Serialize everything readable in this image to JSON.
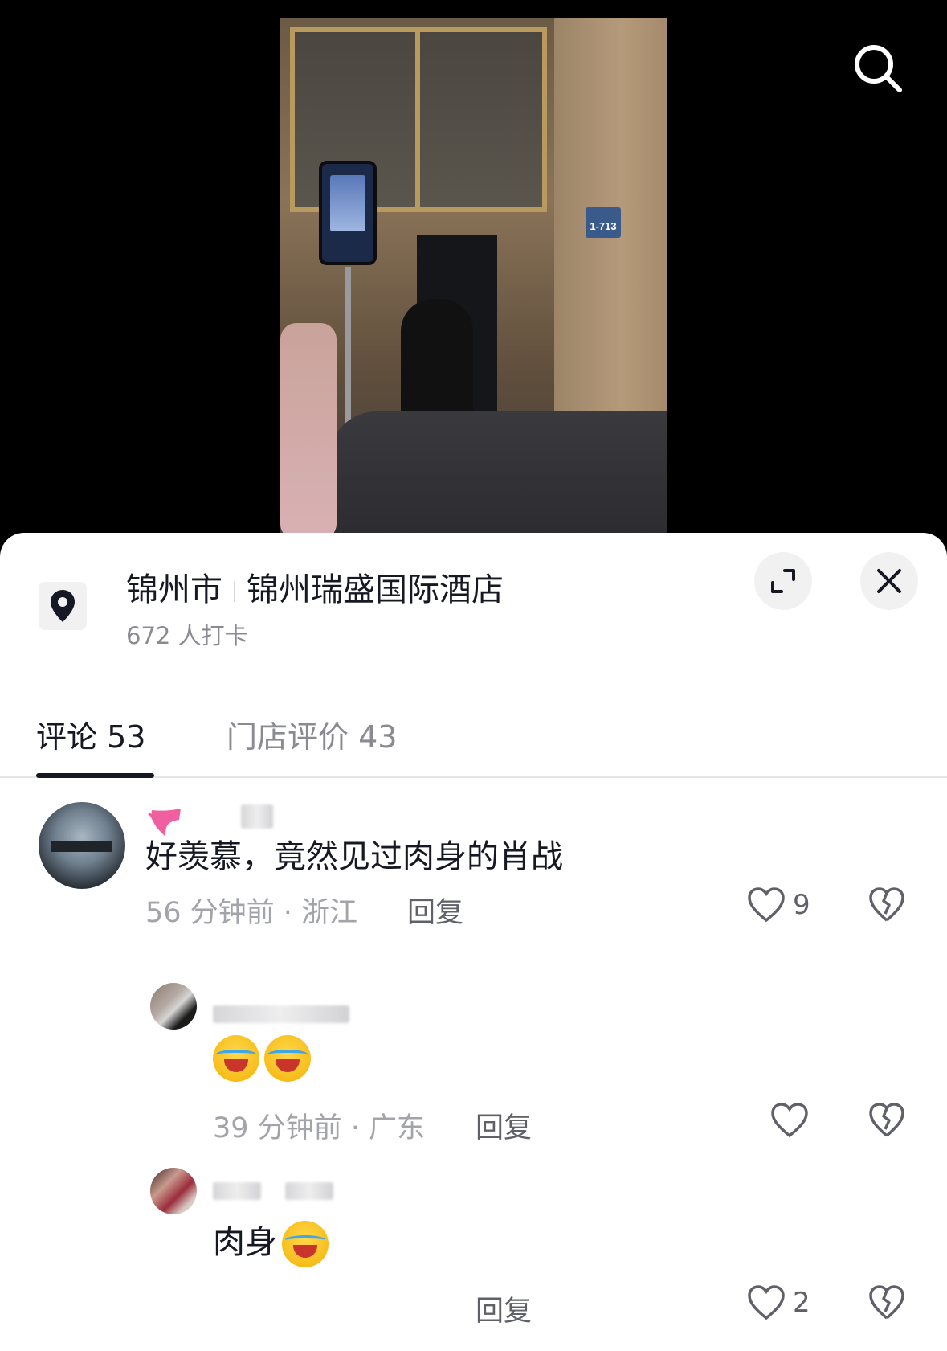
{
  "video": {
    "door_plate": "1-713"
  },
  "icons": {
    "search": "search-icon",
    "location": "location-pin-icon",
    "expand": "expand-icon",
    "close": "close-icon",
    "like": "heart-icon",
    "dislike": "broken-heart-icon"
  },
  "location": {
    "city": "锦州市",
    "place": "锦州瑞盛国际酒店",
    "checkins": "672 人打卡"
  },
  "tabs": [
    {
      "label": "评论 53",
      "active": true
    },
    {
      "label": "门店评价 43",
      "active": false
    }
  ],
  "comments": [
    {
      "text": "好羡慕，竟然见过肉身的肖战",
      "meta": "56 分钟前 · 浙江",
      "reply_label": "回复",
      "likes": "9"
    },
    {
      "text": "",
      "meta": "39 分钟前 · 广东",
      "reply_label": "回复",
      "likes": ""
    },
    {
      "text": "肉身",
      "meta": "",
      "reply_label": "回复",
      "likes": "2"
    }
  ],
  "colors": {
    "text_primary": "#161823",
    "text_secondary": "#8a8b91",
    "sheet_bg": "#ffffff",
    "tab_underline": "#161823"
  }
}
